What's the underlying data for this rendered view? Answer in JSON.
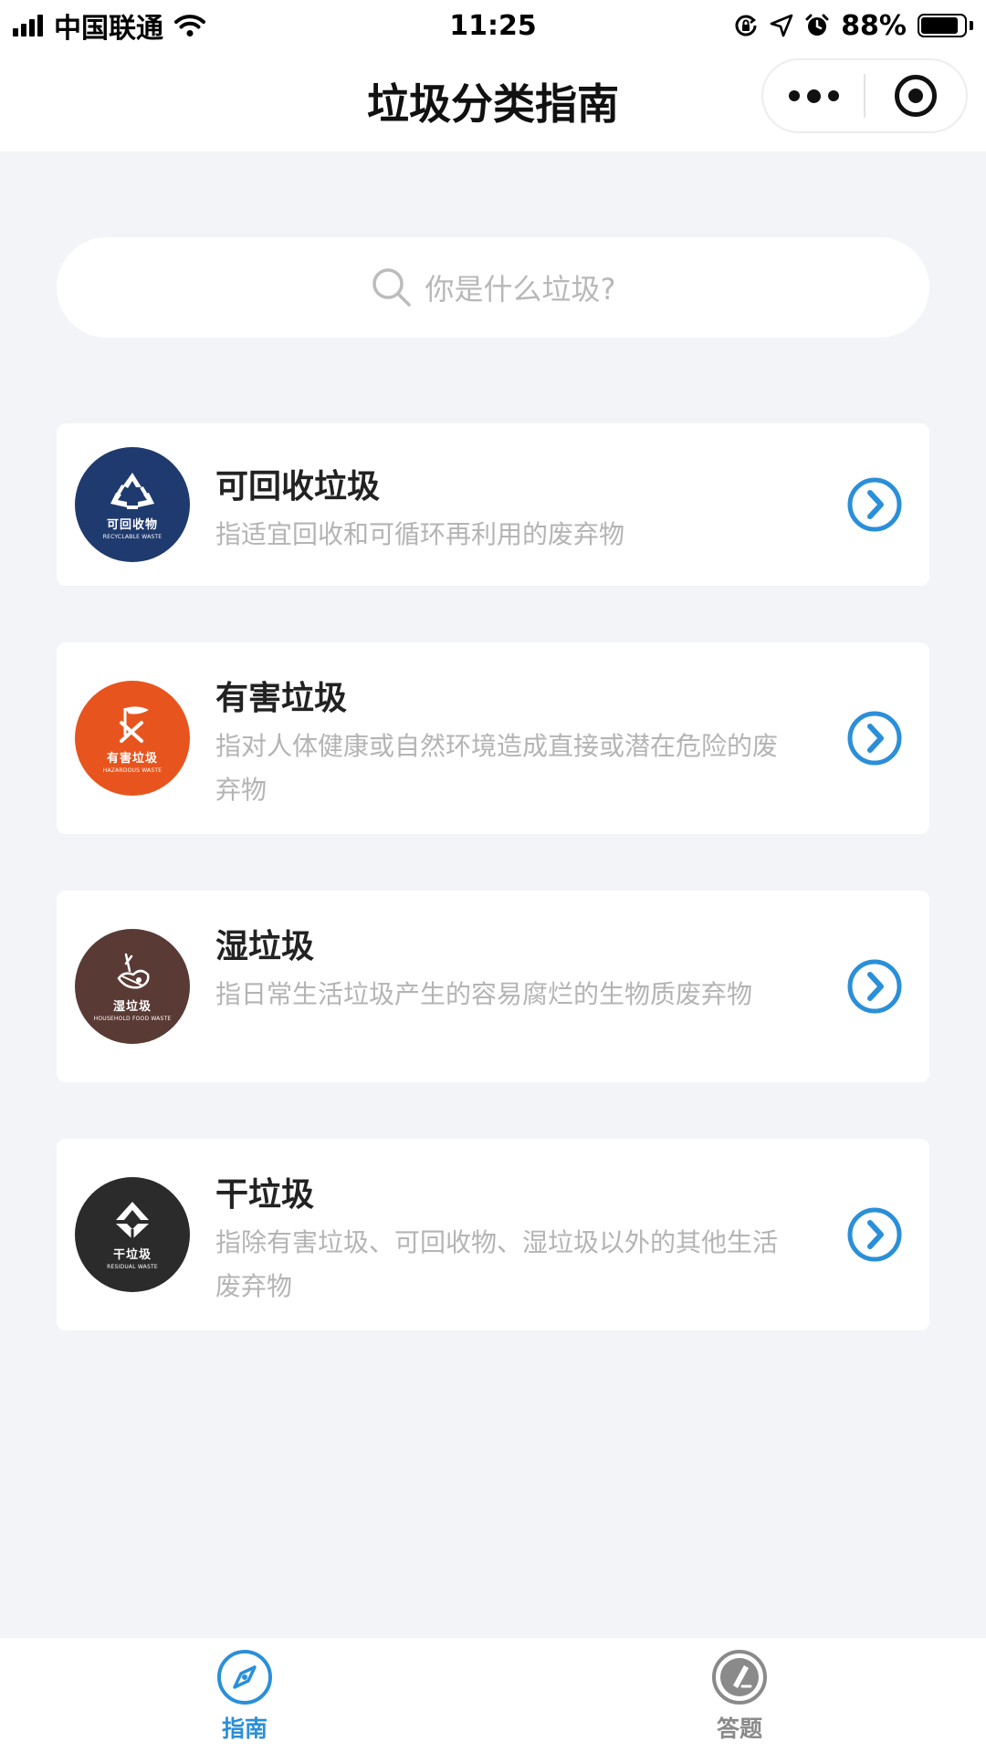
{
  "status_bar": {
    "carrier": "中国联通",
    "time": "11:25",
    "battery": "88%",
    "battery_level": 0.88
  },
  "nav": {
    "title": "垃圾分类指南"
  },
  "search": {
    "placeholder": "你是什么垃圾?"
  },
  "categories": [
    {
      "title": "可回收垃圾",
      "description": "指适宜回收和可循环再利用的废弃物",
      "icon_cn": "可回收物",
      "icon_en": "RECYCLABLE WASTE",
      "color": "#1f3a6e"
    },
    {
      "title": "有害垃圾",
      "description": "指对人体健康或自然环境造成直接或潜在危险的废弃物",
      "icon_cn": "有害垃圾",
      "icon_en": "HAZARDOUS WASTE",
      "color": "#e8541e"
    },
    {
      "title": "湿垃圾",
      "description": "指日常生活垃圾产生的容易腐烂的生物质废弃物",
      "icon_cn": "湿垃圾",
      "icon_en": "HOUSEHOLD FOOD WASTE",
      "color": "#5a3a34"
    },
    {
      "title": "干垃圾",
      "description": "指除有害垃圾、可回收物、湿垃圾以外的其他生活废弃物",
      "icon_cn": "干垃圾",
      "icon_en": "RESIDUAL WASTE",
      "color": "#2b2b2b"
    }
  ],
  "tabs": [
    {
      "label": "指南",
      "active": true
    },
    {
      "label": "答题",
      "active": false
    }
  ],
  "colors": {
    "accent": "#2b8fd8",
    "page_bg": "#f2f4f8",
    "inactive": "#8a8a8a"
  }
}
